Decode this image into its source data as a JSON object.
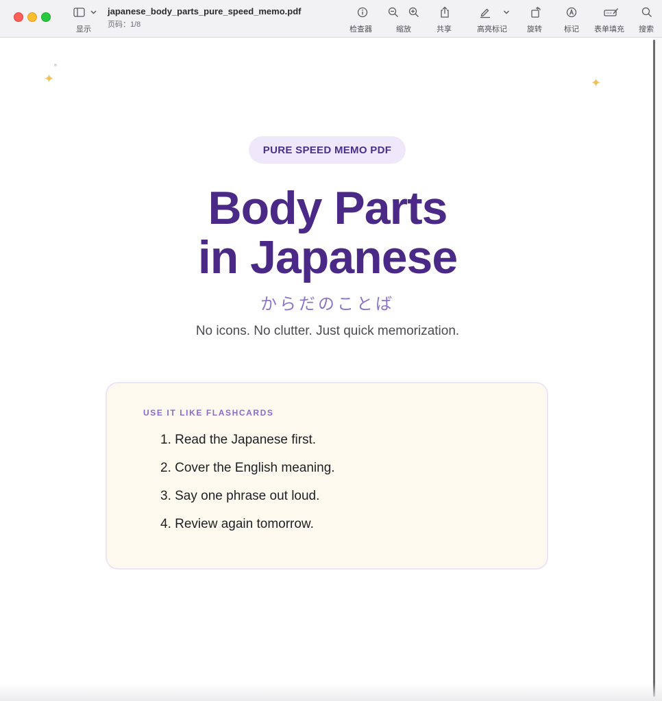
{
  "toolbar": {
    "file_name": "japanese_body_parts_pure_speed_memo.pdf",
    "page_info": "页码：1/8",
    "buttons": {
      "display": "显示",
      "inspector": "检查器",
      "zoom": "缩放",
      "share": "共享",
      "highlight": "高亮标记",
      "rotate": "旋转",
      "markup": "标记",
      "form_fill": "表单填充",
      "search": "搜索"
    }
  },
  "page": {
    "badge": "PURE SPEED MEMO PDF",
    "title_line1": "Body Parts",
    "title_line2": "in Japanese",
    "subtitle_jp": "からだのことば",
    "tagline": "No icons. No clutter. Just quick memorization.",
    "card": {
      "heading": "USE IT LIKE FLASHCARDS",
      "steps": [
        "1. Read the Japanese first.",
        "2. Cover the English meaning.",
        "3. Say one phrase out loud.",
        "4. Review again tomorrow."
      ]
    }
  },
  "colors": {
    "accent": "#4a2a86",
    "badge_bg": "#efe8fb",
    "card_bg": "#fdf9ee",
    "sparkle": "#f0c25a"
  }
}
